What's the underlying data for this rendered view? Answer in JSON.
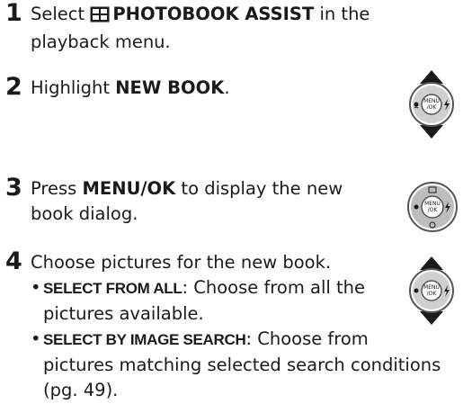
{
  "steps": [
    {
      "number": "1",
      "pre": "Select ",
      "icon": "photobook-icon",
      "bold": "PHOTOBOOK ASSIST",
      "post": " in the",
      "line2": "playback menu."
    },
    {
      "number": "2",
      "pre": "Highlight ",
      "bold": "NEW BOOK",
      "post": "."
    },
    {
      "number": "3",
      "pre": "Press ",
      "bold": "MENU/OK",
      "post": " to display the new",
      "line2": "book dialog."
    },
    {
      "number": "4",
      "text": "Choose pictures for the new book.",
      "options": [
        {
          "label": "SELECT FROM ALL",
          "sep": ": ",
          "desc1": "Choose from all the",
          "desc2": "pictures available."
        },
        {
          "label": "SELECT BY IMAGE SEARCH",
          "sep": ": ",
          "desc1": "Choose from",
          "desc2": "pictures matching selected search conditions",
          "desc3": "(pg. 49)."
        }
      ]
    }
  ],
  "dials": {
    "center_label": "MENU/OK",
    "center_line1": "MENU",
    "center_line2": "/OK",
    "icons": [
      "up-arrow-icon",
      "down-arrow-icon",
      "macro-flower-icon",
      "flash-icon",
      "trash-icon",
      "self-timer-icon"
    ]
  }
}
